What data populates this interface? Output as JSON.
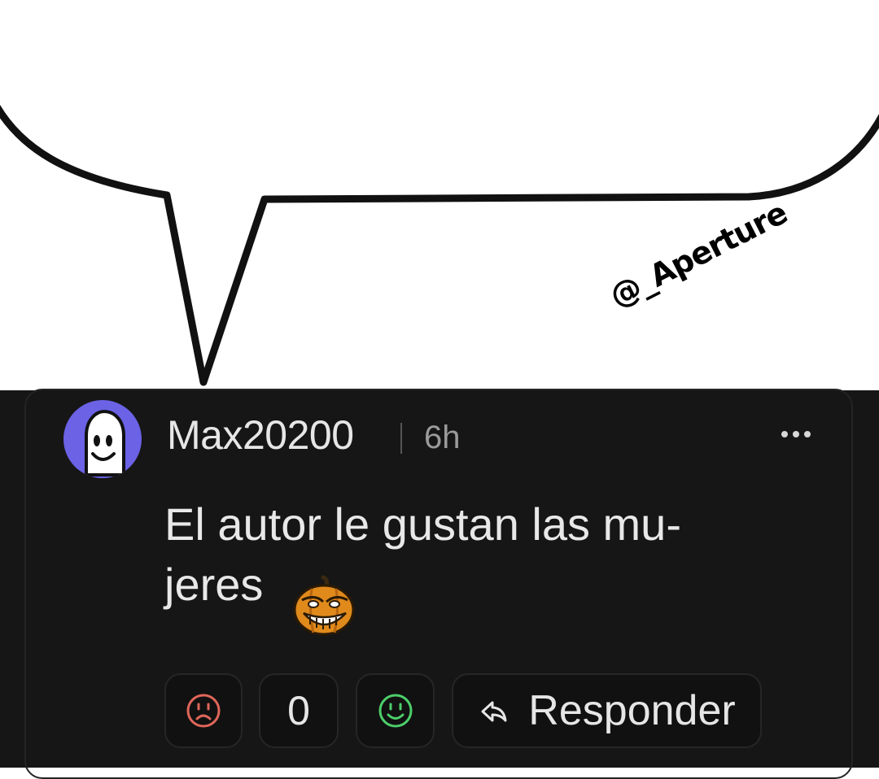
{
  "meme": {
    "watermark": "@_Aperture"
  },
  "comment": {
    "username": "Max20200",
    "time": "6h",
    "text_line1": "El autor le gustan las mu-",
    "text_line2": "jeres",
    "emoji": "pumpkin-trollface-emoji",
    "vote_count": "0",
    "reply_label": "Responder"
  },
  "colors": {
    "panel_bg": "#161616",
    "avatar_bg": "#6b62e6",
    "downvote": "#e0665a",
    "upvote": "#4ccf6a",
    "text": "#e6e6e6",
    "muted": "#9a9a9a"
  },
  "icons": {
    "downvote": "sad-face-icon",
    "upvote": "smiley-face-icon",
    "reply": "reply-arrow-icon",
    "more": "more-dots-icon"
  }
}
